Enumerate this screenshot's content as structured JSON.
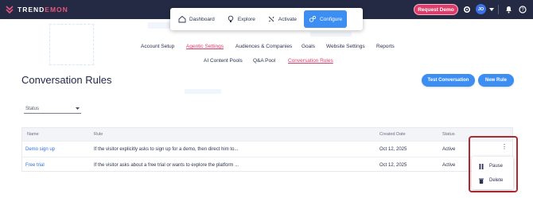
{
  "header": {
    "logo_text_1": "TREND",
    "logo_text_2": "EMON",
    "request_demo": "Request Demo",
    "avatar_initials": "JO"
  },
  "main_nav": [
    {
      "label": "Dashboard",
      "icon": "dashboard-icon"
    },
    {
      "label": "Explore",
      "icon": "lightbulb-icon"
    },
    {
      "label": "Activate",
      "icon": "activate-icon"
    },
    {
      "label": "Configure",
      "icon": "gears-icon",
      "active": true
    }
  ],
  "sub_nav": {
    "row1": [
      "Account Setup",
      "Agentic Settings",
      "Audiences & Companies",
      "Goals",
      "Website Settings",
      "Reports"
    ],
    "row2": [
      "AI Content Pools",
      "Q&A Pool",
      "Conversation Rules"
    ]
  },
  "page": {
    "title": "Conversation Rules",
    "test_button": "Test Conversation",
    "new_rule_button": "New Rule",
    "status_filter": "Status"
  },
  "table": {
    "columns": [
      "Name",
      "Rule",
      "Created Date",
      "Status"
    ],
    "rows": [
      {
        "name": "Demo sign up",
        "rule": "If the visitor explicitly asks to sign up for a demo, then direct him to...",
        "created": "Oct 12, 2025",
        "status": "Active"
      },
      {
        "name": "Free trial",
        "rule": "If the visitor asks about a free trial or wants to explore the platform ...",
        "created": "Oct 12, 2025",
        "status": "Active"
      }
    ]
  },
  "row_menu": {
    "pause": "Pause",
    "delete": "Delete"
  },
  "colors": {
    "topbar": "#242a43",
    "primary": "#3c8ef2",
    "brand_pink": "#d93f6a",
    "highlight_box": "#b02830"
  }
}
